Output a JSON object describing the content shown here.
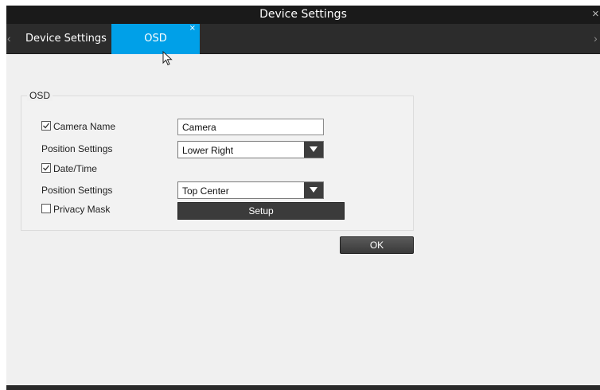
{
  "window": {
    "title": "Device Settings",
    "close_icon": "close-icon"
  },
  "tabs": {
    "items": [
      {
        "label": "Device Settings",
        "active": false
      },
      {
        "label": "OSD",
        "active": true,
        "closable": true
      }
    ],
    "active_color": "#00a0e8",
    "tab_close_glyph": "×",
    "nav_left_glyph": "‹",
    "nav_right_glyph": "›"
  },
  "osd": {
    "group_title": "OSD",
    "camera_name": {
      "label": "Camera Name",
      "checked": true,
      "value": "Camera"
    },
    "camera_name_position": {
      "label": "Position Settings",
      "selected": "Lower Right"
    },
    "date_time": {
      "label": "Date/Time",
      "checked": true
    },
    "date_time_position": {
      "label": "Position Settings",
      "selected": "Top Center"
    },
    "privacy_mask": {
      "label": "Privacy Mask",
      "checked": false
    },
    "setup_label": "Setup"
  },
  "ok_label": "OK",
  "colors": {
    "titlebar": "#1a1a1a",
    "tabbar": "#2c2c2c",
    "content": "#f0f0f0",
    "button": "#3b3b3b"
  }
}
